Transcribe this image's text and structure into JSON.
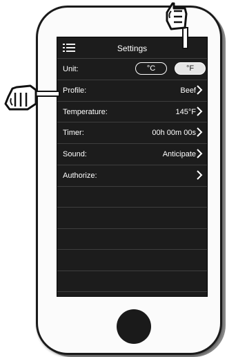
{
  "header": {
    "title": "Settings",
    "menu_icon": "hamburger-menu-icon"
  },
  "unit": {
    "label": "Unit:",
    "celsius": "°C",
    "fahrenheit": "°F",
    "selected": "°F"
  },
  "settings": [
    {
      "label": "Profile:",
      "value": "Beef"
    },
    {
      "label": "Temperature:",
      "value": "145°F"
    },
    {
      "label": "Timer:",
      "value": "00h 00m 00s"
    },
    {
      "label": "Sound:",
      "value": "Anticipate"
    },
    {
      "label": "Authorize:",
      "value": ""
    }
  ],
  "colors": {
    "screen": "#1c1c1c",
    "divider": "#3e3e3e",
    "text": "#ffffff",
    "toggle_selected": "#e6e6e6"
  }
}
